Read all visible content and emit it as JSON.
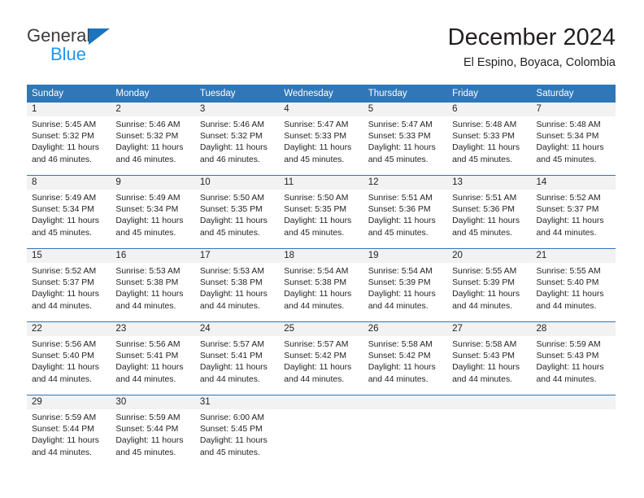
{
  "brand": {
    "name_top": "General",
    "name_bottom": "Blue",
    "triangle_color": "#1b74bc",
    "blue_text_color": "#2196ef"
  },
  "header": {
    "title": "December 2024",
    "subtitle": "El Espino, Boyaca, Colombia"
  },
  "colors": {
    "header_blue": "#2f77b8",
    "date_band_gray": "#f2f2f2",
    "text": "#231f20"
  },
  "weekdays": [
    "Sunday",
    "Monday",
    "Tuesday",
    "Wednesday",
    "Thursday",
    "Friday",
    "Saturday"
  ],
  "weeks": [
    {
      "days": [
        {
          "num": "1",
          "lines": [
            "Sunrise: 5:45 AM",
            "Sunset: 5:32 PM",
            "Daylight: 11 hours",
            "and 46 minutes."
          ]
        },
        {
          "num": "2",
          "lines": [
            "Sunrise: 5:46 AM",
            "Sunset: 5:32 PM",
            "Daylight: 11 hours",
            "and 46 minutes."
          ]
        },
        {
          "num": "3",
          "lines": [
            "Sunrise: 5:46 AM",
            "Sunset: 5:32 PM",
            "Daylight: 11 hours",
            "and 46 minutes."
          ]
        },
        {
          "num": "4",
          "lines": [
            "Sunrise: 5:47 AM",
            "Sunset: 5:33 PM",
            "Daylight: 11 hours",
            "and 45 minutes."
          ]
        },
        {
          "num": "5",
          "lines": [
            "Sunrise: 5:47 AM",
            "Sunset: 5:33 PM",
            "Daylight: 11 hours",
            "and 45 minutes."
          ]
        },
        {
          "num": "6",
          "lines": [
            "Sunrise: 5:48 AM",
            "Sunset: 5:33 PM",
            "Daylight: 11 hours",
            "and 45 minutes."
          ]
        },
        {
          "num": "7",
          "lines": [
            "Sunrise: 5:48 AM",
            "Sunset: 5:34 PM",
            "Daylight: 11 hours",
            "and 45 minutes."
          ]
        }
      ]
    },
    {
      "days": [
        {
          "num": "8",
          "lines": [
            "Sunrise: 5:49 AM",
            "Sunset: 5:34 PM",
            "Daylight: 11 hours",
            "and 45 minutes."
          ]
        },
        {
          "num": "9",
          "lines": [
            "Sunrise: 5:49 AM",
            "Sunset: 5:34 PM",
            "Daylight: 11 hours",
            "and 45 minutes."
          ]
        },
        {
          "num": "10",
          "lines": [
            "Sunrise: 5:50 AM",
            "Sunset: 5:35 PM",
            "Daylight: 11 hours",
            "and 45 minutes."
          ]
        },
        {
          "num": "11",
          "lines": [
            "Sunrise: 5:50 AM",
            "Sunset: 5:35 PM",
            "Daylight: 11 hours",
            "and 45 minutes."
          ]
        },
        {
          "num": "12",
          "lines": [
            "Sunrise: 5:51 AM",
            "Sunset: 5:36 PM",
            "Daylight: 11 hours",
            "and 45 minutes."
          ]
        },
        {
          "num": "13",
          "lines": [
            "Sunrise: 5:51 AM",
            "Sunset: 5:36 PM",
            "Daylight: 11 hours",
            "and 45 minutes."
          ]
        },
        {
          "num": "14",
          "lines": [
            "Sunrise: 5:52 AM",
            "Sunset: 5:37 PM",
            "Daylight: 11 hours",
            "and 44 minutes."
          ]
        }
      ]
    },
    {
      "days": [
        {
          "num": "15",
          "lines": [
            "Sunrise: 5:52 AM",
            "Sunset: 5:37 PM",
            "Daylight: 11 hours",
            "and 44 minutes."
          ]
        },
        {
          "num": "16",
          "lines": [
            "Sunrise: 5:53 AM",
            "Sunset: 5:38 PM",
            "Daylight: 11 hours",
            "and 44 minutes."
          ]
        },
        {
          "num": "17",
          "lines": [
            "Sunrise: 5:53 AM",
            "Sunset: 5:38 PM",
            "Daylight: 11 hours",
            "and 44 minutes."
          ]
        },
        {
          "num": "18",
          "lines": [
            "Sunrise: 5:54 AM",
            "Sunset: 5:38 PM",
            "Daylight: 11 hours",
            "and 44 minutes."
          ]
        },
        {
          "num": "19",
          "lines": [
            "Sunrise: 5:54 AM",
            "Sunset: 5:39 PM",
            "Daylight: 11 hours",
            "and 44 minutes."
          ]
        },
        {
          "num": "20",
          "lines": [
            "Sunrise: 5:55 AM",
            "Sunset: 5:39 PM",
            "Daylight: 11 hours",
            "and 44 minutes."
          ]
        },
        {
          "num": "21",
          "lines": [
            "Sunrise: 5:55 AM",
            "Sunset: 5:40 PM",
            "Daylight: 11 hours",
            "and 44 minutes."
          ]
        }
      ]
    },
    {
      "days": [
        {
          "num": "22",
          "lines": [
            "Sunrise: 5:56 AM",
            "Sunset: 5:40 PM",
            "Daylight: 11 hours",
            "and 44 minutes."
          ]
        },
        {
          "num": "23",
          "lines": [
            "Sunrise: 5:56 AM",
            "Sunset: 5:41 PM",
            "Daylight: 11 hours",
            "and 44 minutes."
          ]
        },
        {
          "num": "24",
          "lines": [
            "Sunrise: 5:57 AM",
            "Sunset: 5:41 PM",
            "Daylight: 11 hours",
            "and 44 minutes."
          ]
        },
        {
          "num": "25",
          "lines": [
            "Sunrise: 5:57 AM",
            "Sunset: 5:42 PM",
            "Daylight: 11 hours",
            "and 44 minutes."
          ]
        },
        {
          "num": "26",
          "lines": [
            "Sunrise: 5:58 AM",
            "Sunset: 5:42 PM",
            "Daylight: 11 hours",
            "and 44 minutes."
          ]
        },
        {
          "num": "27",
          "lines": [
            "Sunrise: 5:58 AM",
            "Sunset: 5:43 PM",
            "Daylight: 11 hours",
            "and 44 minutes."
          ]
        },
        {
          "num": "28",
          "lines": [
            "Sunrise: 5:59 AM",
            "Sunset: 5:43 PM",
            "Daylight: 11 hours",
            "and 44 minutes."
          ]
        }
      ]
    },
    {
      "days": [
        {
          "num": "29",
          "lines": [
            "Sunrise: 5:59 AM",
            "Sunset: 5:44 PM",
            "Daylight: 11 hours",
            "and 44 minutes."
          ]
        },
        {
          "num": "30",
          "lines": [
            "Sunrise: 5:59 AM",
            "Sunset: 5:44 PM",
            "Daylight: 11 hours",
            "and 45 minutes."
          ]
        },
        {
          "num": "31",
          "lines": [
            "Sunrise: 6:00 AM",
            "Sunset: 5:45 PM",
            "Daylight: 11 hours",
            "and 45 minutes."
          ]
        },
        {
          "num": "",
          "lines": [
            "",
            "",
            "",
            ""
          ]
        },
        {
          "num": "",
          "lines": [
            "",
            "",
            "",
            ""
          ]
        },
        {
          "num": "",
          "lines": [
            "",
            "",
            "",
            ""
          ]
        },
        {
          "num": "",
          "lines": [
            "",
            "",
            "",
            ""
          ]
        }
      ]
    }
  ]
}
